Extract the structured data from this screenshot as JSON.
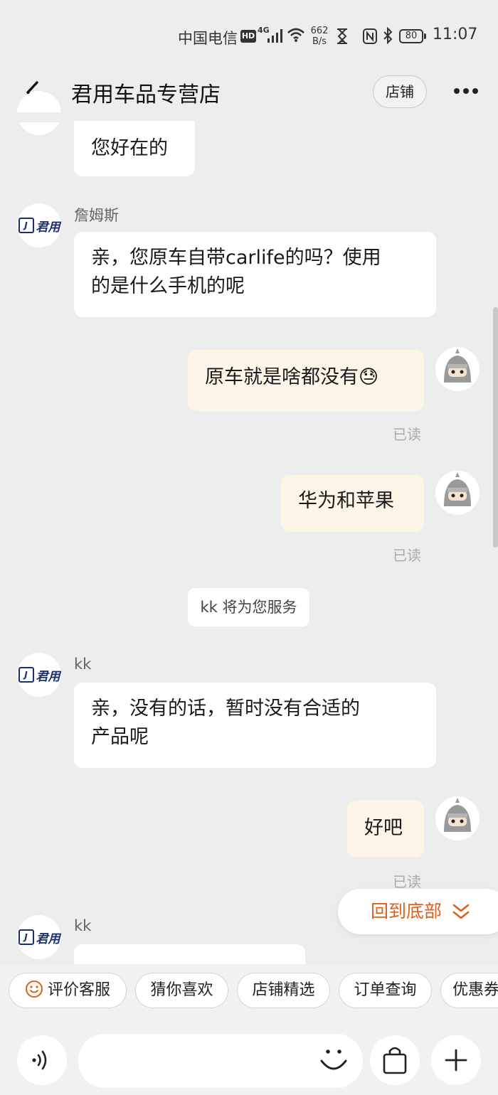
{
  "status_bar": {
    "carrier": "中国电信",
    "hd": "HD",
    "network": "4G",
    "speed_value": "662",
    "speed_unit": "B/s",
    "battery": "80",
    "time": "11:07"
  },
  "header": {
    "title": "君用车品专营店",
    "shop_button": "店铺"
  },
  "shop_logo": {
    "mark": "J",
    "text": "君用"
  },
  "messages": {
    "m1": {
      "text": "您好在的"
    },
    "m2": {
      "sender": "詹姆斯",
      "line1": "亲，您原车自带carlife的吗？使用",
      "line2": "的是什么手机的呢"
    },
    "m3": {
      "text": "原车就是啥都没有",
      "emoji": "😓",
      "status": "已读"
    },
    "m4": {
      "text": "华为和苹果",
      "status": "已读"
    },
    "system": {
      "text": "kk 将为您服务"
    },
    "m5": {
      "sender": "kk",
      "line1": "亲，没有的话，暂时没有合适的",
      "line2": "产品呢"
    },
    "m6": {
      "text": "好吧",
      "status": "已读"
    },
    "m7": {
      "sender": "kk"
    }
  },
  "back_to_bottom": {
    "label": "回到底部"
  },
  "quick_actions": [
    "评价客服",
    "猜你喜欢",
    "店铺精选",
    "订单查询",
    "优惠券"
  ],
  "input": {
    "placeholder": ""
  },
  "colors": {
    "accent": "#e0601b",
    "user_bubble": "#fdf6e6",
    "background": "#ededed"
  }
}
